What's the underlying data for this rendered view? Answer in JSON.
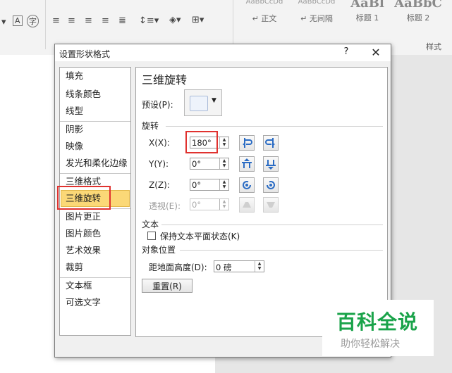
{
  "ribbon": {
    "styles": [
      {
        "preview": "AaBbCcDd",
        "name": "↵ 正文"
      },
      {
        "preview": "AaBbCcDd",
        "name": "↵ 无间隔"
      },
      {
        "preview": "AaBl",
        "name": "标题 1"
      },
      {
        "preview": "AaBbC",
        "name": "标题 2"
      }
    ],
    "styles_group_label": "样式"
  },
  "dialog": {
    "title": "设置形状格式",
    "help": "?",
    "close": "✕",
    "nav": [
      "填充",
      "线条颜色",
      "线型",
      "阴影",
      "映像",
      "发光和柔化边缘",
      "三维格式",
      "三维旋转",
      "图片更正",
      "图片颜色",
      "艺术效果",
      "裁剪",
      "文本框",
      "可选文字"
    ],
    "selected_nav": "三维旋转",
    "panel": {
      "heading": "三维旋转",
      "preset_label": "预设(P):",
      "rotation_section": "旋转",
      "x_label": "X(X):",
      "x_value": "180°",
      "y_label": "Y(Y):",
      "y_value": "0°",
      "z_label": "Z(Z):",
      "z_value": "0°",
      "perspective_label": "透视(E):",
      "perspective_value": "0°",
      "text_section": "文本",
      "keep_flat_label": "保持文本平面状态(K)",
      "object_position_section": "对象位置",
      "distance_label": "距地面高度(D):",
      "distance_value": "0 磅",
      "reset_label": "重置(R)"
    }
  },
  "watermark": {
    "title": "百科全说",
    "subtitle": "助你轻松解决"
  }
}
